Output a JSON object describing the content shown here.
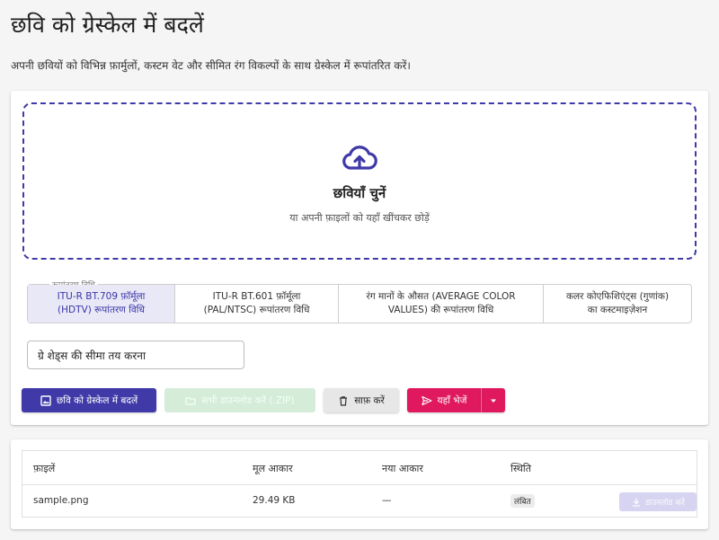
{
  "header": {
    "title": "छवि को ग्रेस्केल में बदलें",
    "subtitle": "अपनी छवियों को विभिन्न फ़ार्मुलों, कस्टम वेट और सीमित रंग विकल्पों के साथ ग्रेस्केल में रूपांतरित करें।"
  },
  "dropzone": {
    "icon": "cloud-upload-icon",
    "title": "छवियाँ चुनें",
    "hint": "या अपनी फ़ाइलों को यहाँ खींचकर छोड़ें"
  },
  "method": {
    "legend": "रूपांतरण विधि",
    "options": [
      {
        "line1": "ITU-R BT.709 फ़ॉर्मूला",
        "line2": "(HDTV) रूपांतरण विधि",
        "selected": true
      },
      {
        "line1": "ITU-R BT.601 फ़ॉर्मूला",
        "line2": "(PAL/NTSC) रूपांतरण विधि",
        "selected": false
      },
      {
        "line1": "रंग मानों के औसत (AVERAGE COLOR",
        "line2": "VALUES) की रूपांतरण विधि",
        "selected": false
      },
      {
        "line1": "कलर कोएफिशिएंट्स (गुणांक)",
        "line2": "का कस्टमाइज़ेशन",
        "selected": false
      }
    ]
  },
  "shades_input": {
    "value": "ग्रे शेड्स की सीमा तय करना"
  },
  "actions": {
    "convert": "छवि को ग्रेस्केल में बदलें",
    "download_all": "सभी डाउनलोड करें (.ZIP)",
    "clear": "साफ़ करें",
    "send": "यहाँ भेजें"
  },
  "table": {
    "headers": [
      "फ़ाइलें",
      "मूल आकार",
      "नया आकार",
      "स्थिति"
    ],
    "rows": [
      {
        "file": "sample.png",
        "original_size": "29.49 KB",
        "new_size": "—",
        "status": "लंबित",
        "download": "डाउनलोड करें"
      }
    ]
  },
  "colors": {
    "primary": "#3f3aa8",
    "accent": "#e0195e",
    "success_disabled": "#d5ecd9"
  }
}
